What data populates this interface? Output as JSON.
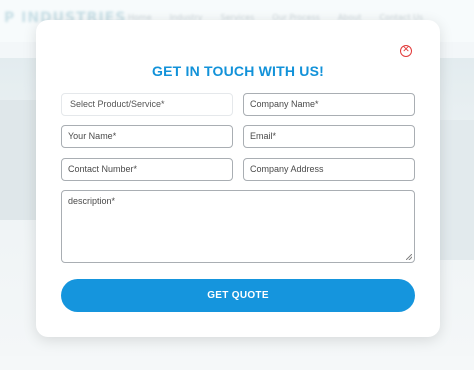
{
  "background": {
    "logo": "P INDUSTRIES",
    "nav": [
      "Home",
      "Industry",
      "Services",
      "Our Process",
      "About",
      "Contact Us"
    ]
  },
  "modal": {
    "title": "GET IN TOUCH WITH US!",
    "close_icon": "close-circle-icon",
    "fields": {
      "product": "Select Product/Service*",
      "company_name": "Company Name*",
      "your_name": "Your Name*",
      "email": "Email*",
      "contact_number": "Contact Number*",
      "company_address": "Company Address",
      "description": "description*"
    },
    "submit_label": "GET QUOTE",
    "colors": {
      "accent": "#1595dd",
      "title": "#1292d9",
      "close": "#e23a3a"
    }
  }
}
